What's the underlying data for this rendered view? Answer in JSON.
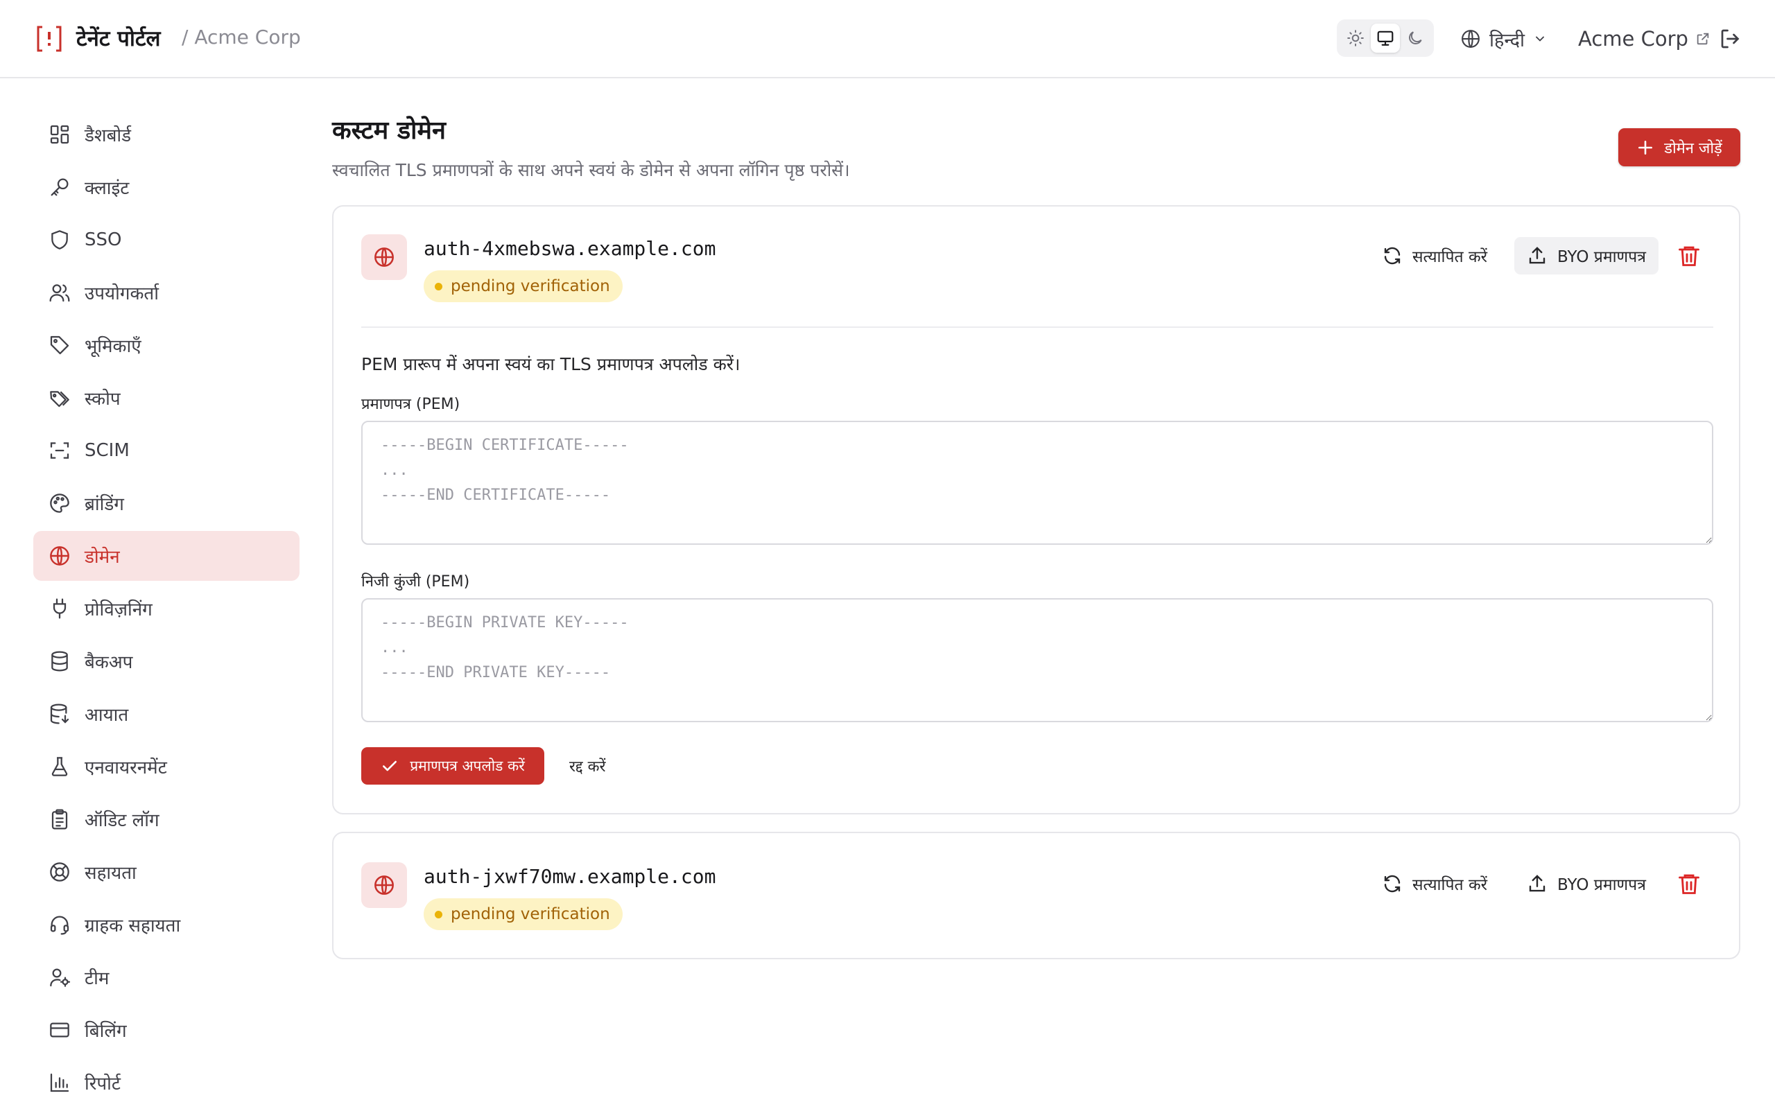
{
  "header": {
    "app_title": "टेनेंट पोर्टल",
    "tenant_crumb": "/ Acme Corp",
    "language": "हिन्दी",
    "org_name": "Acme Corp",
    "theme_modes": [
      "sun-icon",
      "monitor-icon",
      "moon-icon"
    ],
    "active_theme": "monitor-icon"
  },
  "sidebar": {
    "items": [
      {
        "label": "डैशबोर्ड",
        "icon": "dashboard-icon"
      },
      {
        "label": "क्लाइंट",
        "icon": "key-icon"
      },
      {
        "label": "SSO",
        "icon": "shield-icon"
      },
      {
        "label": "उपयोगकर्ता",
        "icon": "users-icon"
      },
      {
        "label": "भूमिकाएँ",
        "icon": "tag-icon"
      },
      {
        "label": "स्कोप",
        "icon": "tags-icon"
      },
      {
        "label": "SCIM",
        "icon": "scan-icon"
      },
      {
        "label": "ब्रांडिंग",
        "icon": "palette-icon"
      },
      {
        "label": "डोमेन",
        "icon": "globe-icon"
      },
      {
        "label": "प्रोविज़निंग",
        "icon": "plug-icon"
      },
      {
        "label": "बैकअप",
        "icon": "database-icon"
      },
      {
        "label": "आयात",
        "icon": "database-import-icon"
      },
      {
        "label": "एनवायरनमेंट",
        "icon": "flask-icon"
      },
      {
        "label": "ऑडिट लॉग",
        "icon": "clipboard-icon"
      },
      {
        "label": "सहायता",
        "icon": "lifebuoy-icon"
      },
      {
        "label": "ग्राहक सहायता",
        "icon": "headset-icon"
      },
      {
        "label": "टीम",
        "icon": "user-cog-icon"
      },
      {
        "label": "बिलिंग",
        "icon": "credit-card-icon"
      },
      {
        "label": "रिपोर्ट",
        "icon": "bar-chart-icon"
      }
    ],
    "active": "डोमेन"
  },
  "main": {
    "title": "कस्टम डोमेन",
    "subtitle": "स्वचालित TLS प्रमाणपत्रों के साथ अपने स्वयं के डोमेन से अपना लॉगिन पृष्ठ परोसें।",
    "add_button": "डोमेन जोड़ें",
    "domains": [
      {
        "name": "auth-4xmebswa.example.com",
        "status": "pending verification",
        "verify_label": "सत्यापित करें",
        "byo_label": "BYO प्रमाणपत्र",
        "expanded": true
      },
      {
        "name": "auth-jxwf70mw.example.com",
        "status": "pending verification",
        "verify_label": "सत्यापित करें",
        "byo_label": "BYO प्रमाणपत्र",
        "expanded": false
      }
    ],
    "byo_form": {
      "instructions": "PEM प्रारूप में अपना स्वयं का TLS प्रमाणपत्र अपलोड करें।",
      "cert_label": "प्रमाणपत्र (PEM)",
      "cert_placeholder": "-----BEGIN CERTIFICATE-----\n...\n-----END CERTIFICATE-----",
      "key_label": "निजी कुंजी (PEM)",
      "key_placeholder": "-----BEGIN PRIVATE KEY-----\n...\n-----END PRIVATE KEY-----",
      "upload_button": "प्रमाणपत्र अपलोड करें",
      "cancel_button": "रद्द करें"
    }
  },
  "colors": {
    "accent": "#c8312b",
    "accent_soft": "#f9e3e3",
    "badge_bg": "#fdf3c4",
    "badge_text": "#a16207",
    "badge_dot": "#eab308"
  }
}
